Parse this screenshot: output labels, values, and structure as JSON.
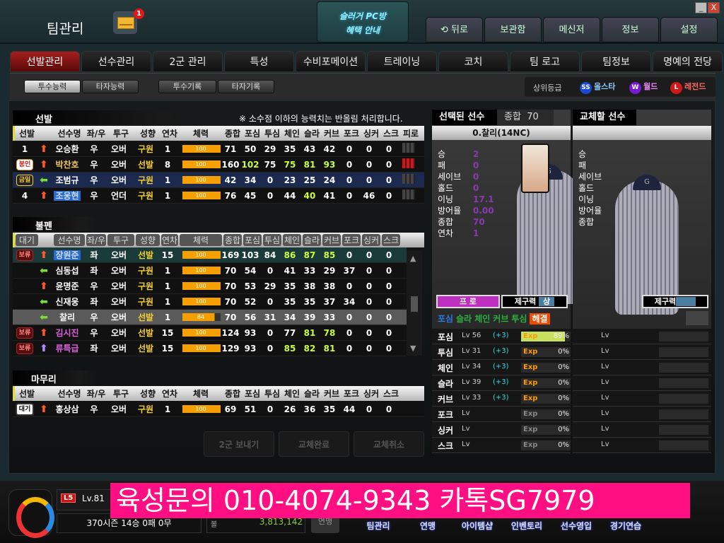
{
  "header": {
    "title": "팀관리",
    "mail_count": "1",
    "pcbang": [
      "슬러거 PC방",
      "혜택 안내"
    ],
    "window": {
      "minimize": "_",
      "close": "X"
    },
    "nav": [
      "뒤로",
      "보관함",
      "메신저",
      "정보",
      "설정"
    ]
  },
  "tabs": [
    "선발관리",
    "선수관리",
    "2군 관리",
    "특성",
    "수비포메이션",
    "트레이닝",
    "코치",
    "팀 로고",
    "팀정보",
    "명예의 전당"
  ],
  "subtabs": [
    "투수능력",
    "타자능력",
    "투수기록",
    "타자기록"
  ],
  "grades": {
    "label": "상위등급",
    "items": [
      {
        "icon": "SS",
        "label": "올스타",
        "color": "#5ab4ff"
      },
      {
        "icon": "W",
        "label": "월드",
        "color": "#e070ff"
      },
      {
        "icon": "L",
        "label": "레전드",
        "color": "#ff4040"
      }
    ]
  },
  "colors": {
    "accent": "#a42020",
    "bar": "#f5a000",
    "highlight": "#ccff33"
  },
  "starters": {
    "title": "선발",
    "note": "※ 소수점 이하의 능력치는 반올림 처리합니다.",
    "headers": [
      "선발",
      "",
      "선수명",
      "좌/우",
      "투구",
      "성향",
      "연차",
      "체력",
      "종합",
      "포심",
      "투심",
      "체인",
      "슬라",
      "커브",
      "포크",
      "싱커",
      "스크",
      "피로"
    ],
    "rows": [
      {
        "slot": "1",
        "arrow": "up",
        "name": "오승환",
        "hand": "우",
        "pitch": "오버",
        "type": "구원",
        "yr": "1",
        "stamina": 100,
        "stats": [
          "71",
          "50",
          "29",
          "35",
          "43",
          "42",
          "0",
          "0",
          "0"
        ],
        "fatigue": "none"
      },
      {
        "slot": "봉인",
        "badge": "bong",
        "arrow": "up",
        "name": "박찬호",
        "namestyle": "gold",
        "hand": "우",
        "pitch": "오버",
        "type": "선발",
        "yr": "8",
        "stamina": 100,
        "stats": [
          "160",
          "102",
          "75",
          "75",
          "81",
          "93",
          "0",
          "0",
          "0"
        ],
        "green": [
          1,
          3,
          4,
          5
        ],
        "fatigue": "red"
      },
      {
        "slot": "금일",
        "badge": "geum",
        "arrow": "left",
        "name": "조범규",
        "hand": "우",
        "pitch": "오버",
        "type": "구원",
        "yr": "1",
        "stamina": 100,
        "stats": [
          "42",
          "34",
          "0",
          "23",
          "25",
          "24",
          "0",
          "0",
          "0"
        ],
        "fatigue": "none",
        "bg": "#1c2a50"
      },
      {
        "slot": "4",
        "arrow": "up",
        "name": "조웅현",
        "namestyle": "blue",
        "hand": "우",
        "pitch": "언더",
        "type": "구원",
        "yr": "1",
        "stamina": 100,
        "stats": [
          "76",
          "45",
          "0",
          "44",
          "40",
          "41",
          "0",
          "46",
          "0"
        ],
        "green": [
          4
        ],
        "fatigue": "none"
      }
    ]
  },
  "bullpen": {
    "title": "불펜",
    "headers": [
      "대기",
      "",
      "선수명",
      "좌/우",
      "투구",
      "성향",
      "연차",
      "체력",
      "종합",
      "포심",
      "투심",
      "체인",
      "슬라",
      "커브",
      "포크",
      "싱커",
      "스크"
    ],
    "rows": [
      {
        "slot": "보류",
        "badge": "bo",
        "arrow": "up",
        "name": "장원준",
        "namestyle": "blue",
        "hand": "좌",
        "pitch": "오버",
        "type": "선발",
        "yr": "15",
        "stamina": 100,
        "stats": [
          "169",
          "103",
          "84",
          "86",
          "87",
          "85",
          "0",
          "0",
          "0"
        ],
        "green": [
          3,
          4,
          5
        ],
        "bg": "#1b3a3a"
      },
      {
        "slot": "",
        "arrow": "left",
        "name": "심동섭",
        "hand": "좌",
        "pitch": "오버",
        "type": "구원",
        "yr": "1",
        "stamina": 100,
        "stats": [
          "70",
          "54",
          "0",
          "41",
          "33",
          "29",
          "37",
          "0",
          "0"
        ]
      },
      {
        "slot": "",
        "arrow": "up",
        "name": "윤명준",
        "hand": "우",
        "pitch": "오버",
        "type": "구원",
        "yr": "1",
        "stamina": 100,
        "stats": [
          "70",
          "53",
          "29",
          "35",
          "38",
          "38",
          "0",
          "0",
          "0"
        ]
      },
      {
        "slot": "",
        "arrow": "left",
        "name": "신재웅",
        "hand": "좌",
        "pitch": "오버",
        "type": "구원",
        "yr": "1",
        "stamina": 100,
        "stats": [
          "70",
          "52",
          "0",
          "35",
          "35",
          "37",
          "34",
          "0",
          "0"
        ]
      },
      {
        "slot": "",
        "arrow": "left",
        "name": "찰리",
        "hand": "우",
        "pitch": "오버",
        "type": "선발",
        "yr": "1",
        "stamina": 84,
        "stats": [
          "70",
          "56",
          "31",
          "34",
          "39",
          "33",
          "0",
          "0",
          "0"
        ],
        "bg": "#5a5a5a"
      },
      {
        "slot": "보류",
        "badge": "bo",
        "arrow": "up",
        "name": "김시진",
        "namestyle": "pink",
        "hand": "우",
        "pitch": "오버",
        "type": "선발",
        "yr": "15",
        "stamina": 100,
        "stats": [
          "124",
          "93",
          "0",
          "77",
          "81",
          "78",
          "0",
          "0",
          "0"
        ],
        "green": [
          4,
          5
        ]
      },
      {
        "slot": "보류",
        "badge": "bo",
        "arrow": "purple",
        "name": "류특급",
        "namestyle": "pink",
        "hand": "좌",
        "pitch": "오버",
        "type": "선발",
        "yr": "15",
        "stamina": 100,
        "stats": [
          "129",
          "93",
          "0",
          "85",
          "82",
          "81",
          "0",
          "0",
          "0"
        ],
        "green": [
          3,
          4,
          5
        ]
      }
    ]
  },
  "closer": {
    "title": "마무리",
    "headers": [
      "선발",
      "",
      "선수명",
      "좌/우",
      "투구",
      "성향",
      "연차",
      "체력",
      "종합",
      "포심",
      "투심",
      "체인",
      "슬라",
      "커브",
      "포크",
      "싱커",
      "스크"
    ],
    "rows": [
      {
        "slot": "대기",
        "badge": "dae",
        "arrow": "up",
        "name": "홍상삼",
        "hand": "우",
        "pitch": "오버",
        "type": "구원",
        "yr": "1",
        "stamina": 100,
        "stats": [
          "69",
          "51",
          "0",
          "26",
          "36",
          "35",
          "44",
          "0",
          "0"
        ]
      }
    ]
  },
  "actions": [
    "2군 보내기",
    "교체완료",
    "교체취소"
  ],
  "selected": {
    "title": "선택된 선수",
    "overall_label": "종합",
    "overall": "70",
    "name": "0.찰리(14NC)",
    "stats": [
      {
        "k": "승",
        "v": "2"
      },
      {
        "k": "패",
        "v": "0"
      },
      {
        "k": "세이브",
        "v": "0"
      },
      {
        "k": "홀드",
        "v": "0"
      },
      {
        "k": "이닝",
        "v": "17.1"
      },
      {
        "k": "방어율",
        "v": "0.00"
      },
      {
        "k": "종합",
        "v": "70"
      },
      {
        "k": "연차",
        "v": "1"
      }
    ],
    "grade": "프 로",
    "control_label": "제구력",
    "control": "상",
    "cap": "G",
    "pitches": [
      {
        "t": "포심",
        "c": "#2a7ae0"
      },
      {
        "t": "슬라",
        "c": "#2ab040"
      },
      {
        "t": "체인",
        "c": "#2ab040"
      },
      {
        "t": "커브",
        "c": "#2ab040"
      },
      {
        "t": "투심",
        "c": "#2ab040"
      }
    ],
    "pitch_tag": "헤결",
    "skills": [
      {
        "n": "포심",
        "lv": "56",
        "plus": "(+3)",
        "exp": 89
      },
      {
        "n": "투심",
        "lv": "31",
        "plus": "(+3)",
        "exp": 0
      },
      {
        "n": "체인",
        "lv": "34",
        "plus": "(+3)",
        "exp": 0
      },
      {
        "n": "슬라",
        "lv": "39",
        "plus": "(+3)",
        "exp": 0
      },
      {
        "n": "커브",
        "lv": "33",
        "plus": "(+3)",
        "exp": 0
      },
      {
        "n": "포크",
        "lv": "",
        "plus": "",
        "exp": 0,
        "gray": true
      },
      {
        "n": "싱커",
        "lv": "",
        "plus": "",
        "exp": 0,
        "gray": true
      },
      {
        "n": "스크",
        "lv": "",
        "plus": "",
        "exp": 0,
        "gray": true
      }
    ],
    "lv_label": "Lv",
    "exp_label": "Exp"
  },
  "replace": {
    "title": "교체할 선수",
    "stats": [
      "승",
      "패",
      "세이브",
      "홀드",
      "이닝",
      "방어율",
      "종합"
    ],
    "control_label": "제구력",
    "lv_label": "Lv",
    "cap": "G"
  },
  "bottom": {
    "level_badge": "L5",
    "level": "Lv.81",
    "season": "370시즌  14승  0패  0무",
    "money_label": "볼",
    "money": "3,813,142",
    "yeonmaeng": "연맹",
    "nav": [
      "팀관리",
      "연맹",
      "아이템샵",
      "인벤토리",
      "선수영입",
      "경기연습"
    ]
  },
  "banner": "육성문의 010-4074-9343 카톡SG7979"
}
